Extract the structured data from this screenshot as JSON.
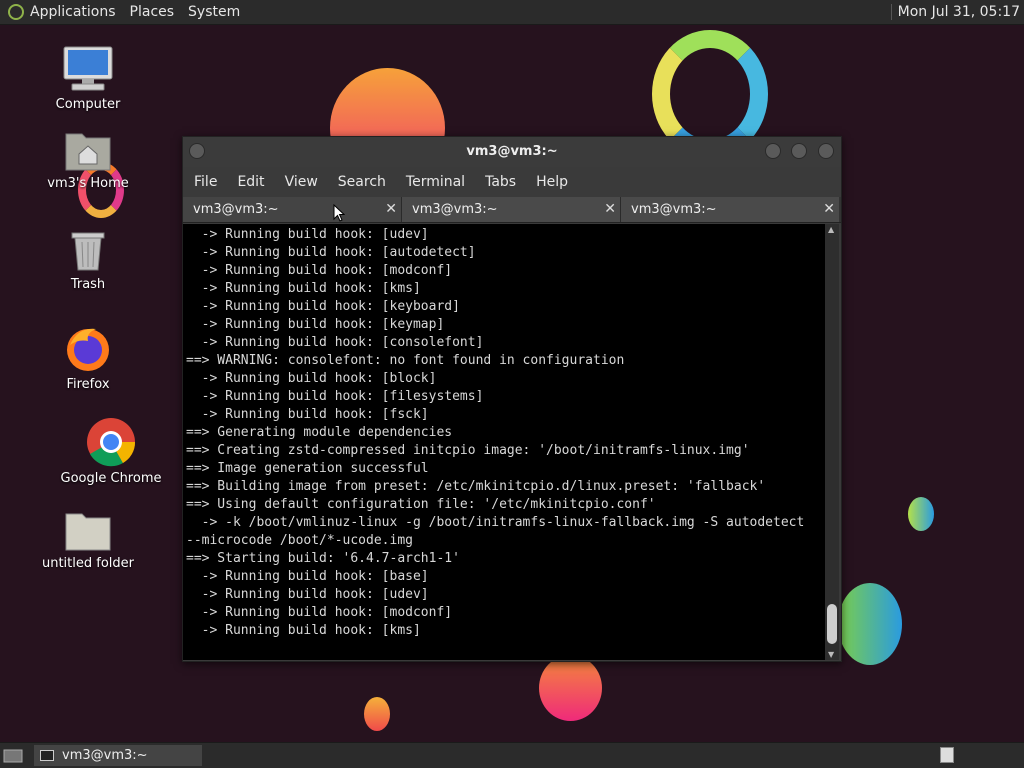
{
  "top_panel": {
    "menus": [
      "Applications",
      "Places",
      "System"
    ],
    "clock": "Mon Jul 31, 05:17"
  },
  "desktop": {
    "icons": [
      {
        "label": "Computer",
        "icon": "computer-icon"
      },
      {
        "label": "vm3's Home",
        "icon": "home-folder-icon"
      },
      {
        "label": "Trash",
        "icon": "trash-icon"
      },
      {
        "label": "Firefox",
        "icon": "firefox-icon"
      },
      {
        "label": "Google Chrome",
        "icon": "chrome-icon"
      },
      {
        "label": "untitled folder",
        "icon": "folder-icon"
      }
    ]
  },
  "window": {
    "title": "vm3@vm3:~",
    "menu": [
      "File",
      "Edit",
      "View",
      "Search",
      "Terminal",
      "Tabs",
      "Help"
    ],
    "tabs": [
      {
        "label": "vm3@vm3:~",
        "active": true
      },
      {
        "label": "vm3@vm3:~",
        "active": false
      },
      {
        "label": "vm3@vm3:~",
        "active": false
      }
    ],
    "terminal_lines": [
      "  -> Running build hook: [udev]",
      "  -> Running build hook: [autodetect]",
      "  -> Running build hook: [modconf]",
      "  -> Running build hook: [kms]",
      "  -> Running build hook: [keyboard]",
      "  -> Running build hook: [keymap]",
      "  -> Running build hook: [consolefont]",
      "==> WARNING: consolefont: no font found in configuration",
      "  -> Running build hook: [block]",
      "  -> Running build hook: [filesystems]",
      "  -> Running build hook: [fsck]",
      "==> Generating module dependencies",
      "==> Creating zstd-compressed initcpio image: '/boot/initramfs-linux.img'",
      "==> Image generation successful",
      "==> Building image from preset: /etc/mkinitcpio.d/linux.preset: 'fallback'",
      "==> Using default configuration file: '/etc/mkinitcpio.conf'",
      "  -> -k /boot/vmlinuz-linux -g /boot/initramfs-linux-fallback.img -S autodetect",
      "--microcode /boot/*-ucode.img",
      "==> Starting build: '6.4.7-arch1-1'",
      "  -> Running build hook: [base]",
      "  -> Running build hook: [udev]",
      "  -> Running build hook: [modconf]",
      "  -> Running build hook: [kms]"
    ]
  },
  "taskbar": {
    "items": [
      {
        "label": "vm3@vm3:~"
      }
    ]
  }
}
